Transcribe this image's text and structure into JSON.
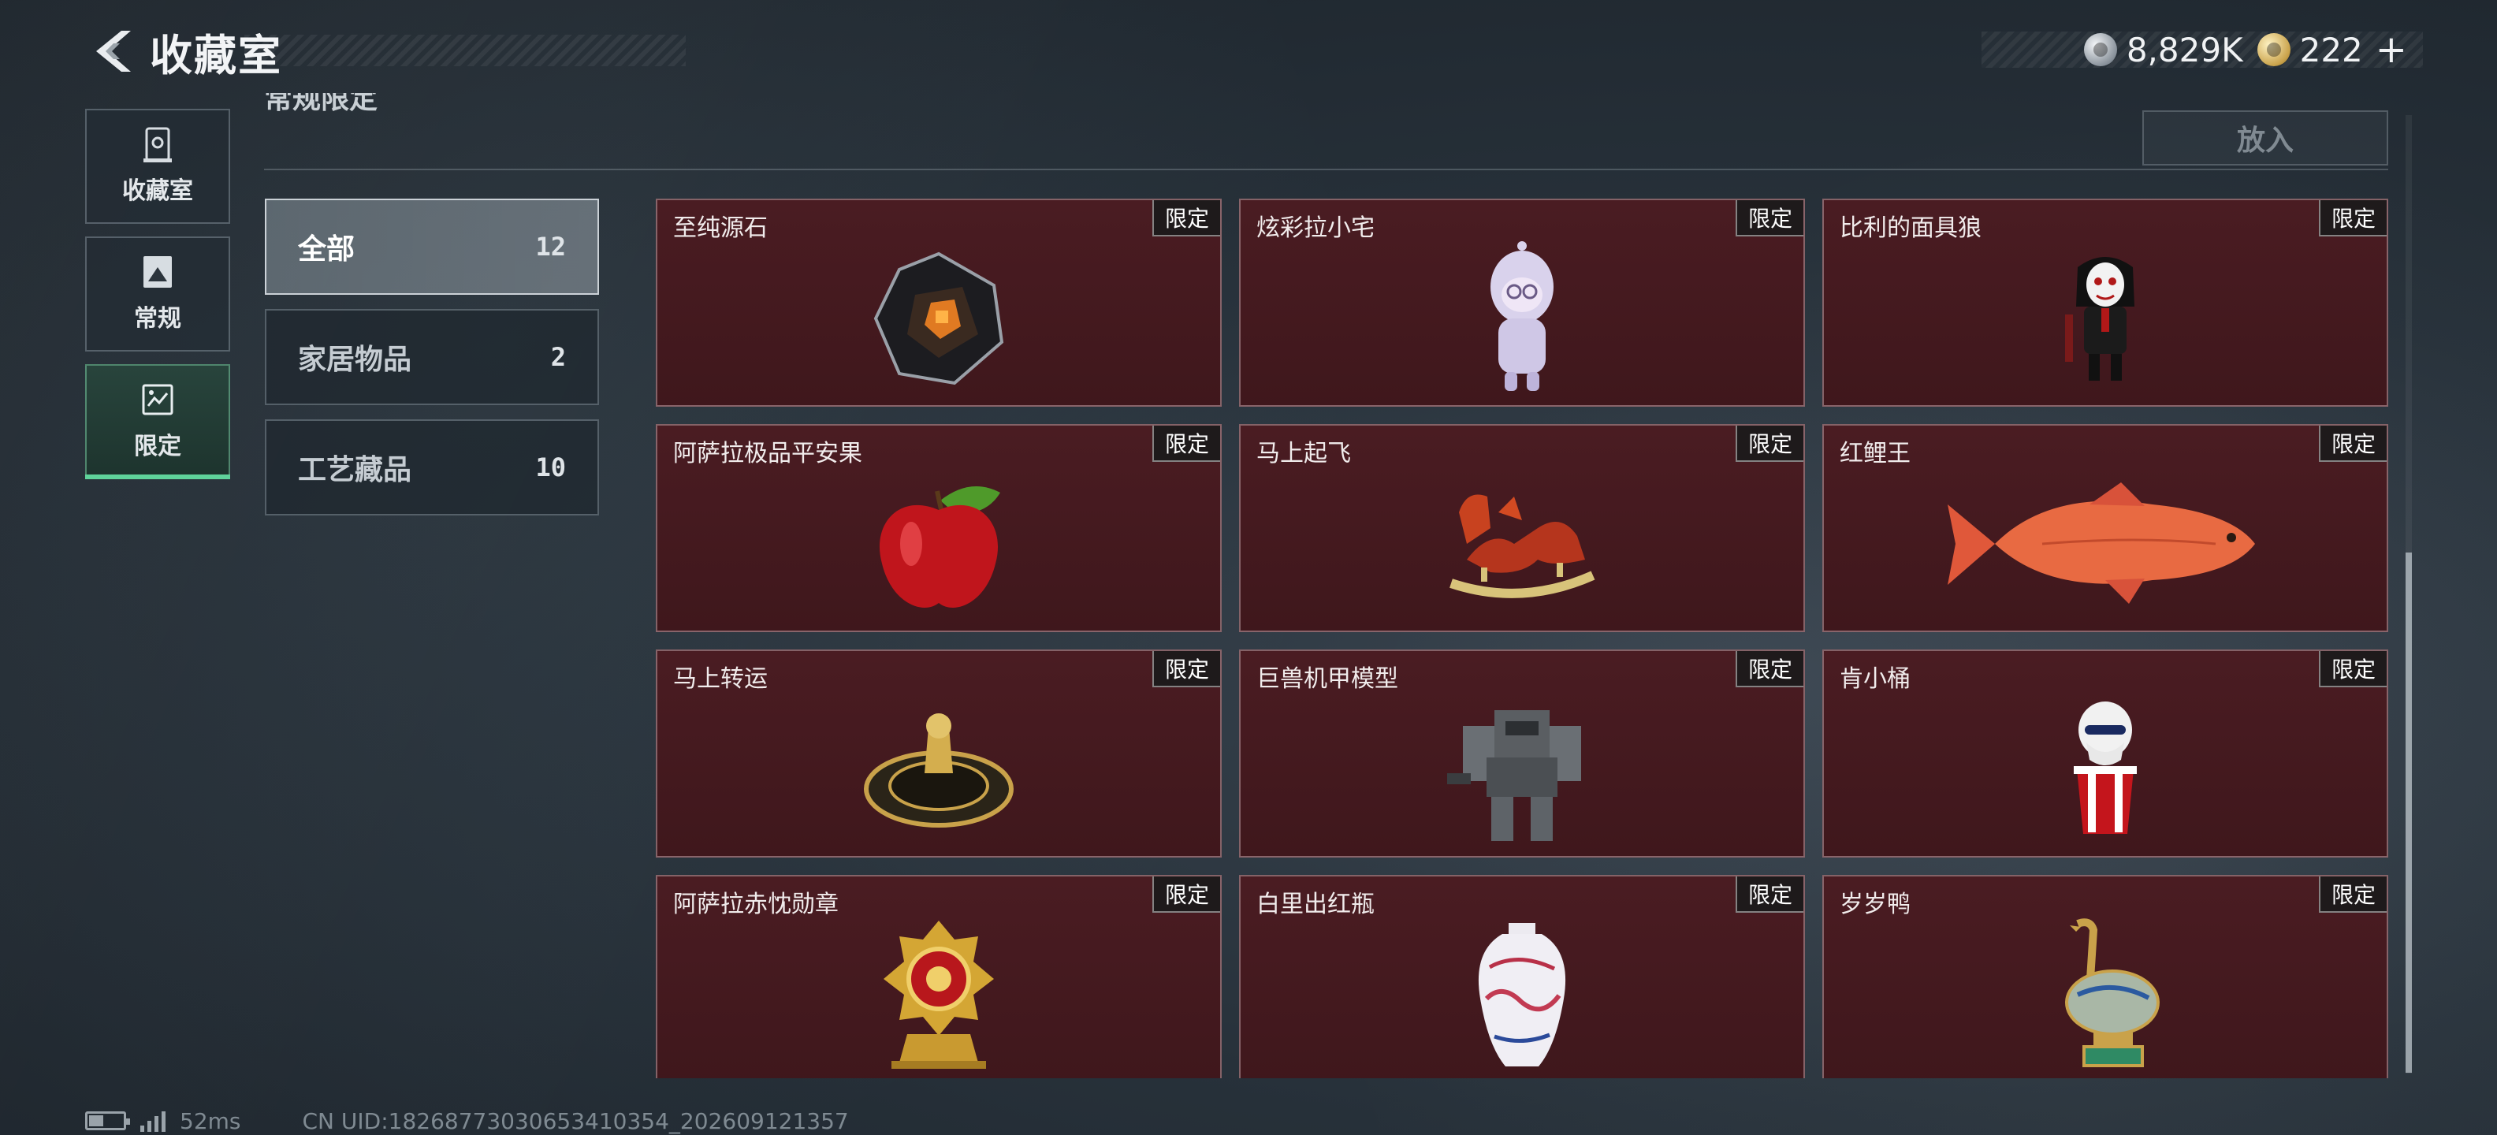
{
  "header": {
    "title": "收藏室",
    "currency": [
      {
        "icon": "silver-coin-icon",
        "value": "8,829K"
      },
      {
        "icon": "gold-coin-icon",
        "value": "222"
      }
    ],
    "add_label": "+"
  },
  "nav": {
    "items": [
      {
        "label": "收藏室",
        "icon": "trophy-case-icon",
        "active": false
      },
      {
        "label": "常规",
        "icon": "photo-frame-icon",
        "active": false
      },
      {
        "label": "限定",
        "icon": "limited-frame-icon",
        "active": true
      }
    ]
  },
  "section": {
    "label": "常规限定",
    "deposit_label": "放入"
  },
  "categories": [
    {
      "label": "全部",
      "count": "12",
      "active": true
    },
    {
      "label": "家居物品",
      "count": "2",
      "active": false
    },
    {
      "label": "工艺藏品",
      "count": "10",
      "active": false
    }
  ],
  "items": [
    {
      "name": "至纯源石",
      "tag": "限定",
      "art": "crystal"
    },
    {
      "name": "炫彩拉小宅",
      "tag": "限定",
      "art": "figure"
    },
    {
      "name": "比利的面具狼",
      "tag": "限定",
      "art": "puppet"
    },
    {
      "name": "阿萨拉极品平安果",
      "tag": "限定",
      "art": "apple"
    },
    {
      "name": "马上起飞",
      "tag": "限定",
      "art": "horse"
    },
    {
      "name": "红鲤王",
      "tag": "限定",
      "art": "fish"
    },
    {
      "name": "马上转运",
      "tag": "限定",
      "art": "wheel"
    },
    {
      "name": "巨兽机甲模型",
      "tag": "限定",
      "art": "mech"
    },
    {
      "name": "肯小桶",
      "tag": "限定",
      "art": "bucket"
    },
    {
      "name": "阿萨拉赤忱勋章",
      "tag": "限定",
      "art": "medal"
    },
    {
      "name": "白里出红瓶",
      "tag": "限定",
      "art": "vase"
    },
    {
      "name": "岁岁鸭",
      "tag": "限定",
      "art": "duck"
    }
  ],
  "footer": {
    "ping": "52ms",
    "uid": "CN UID:18268773030653410354_202609121357"
  },
  "colors": {
    "card_bg": "#4a1c22",
    "active_nav_accent": "#5fd39a",
    "page_bg": "#27313a"
  }
}
